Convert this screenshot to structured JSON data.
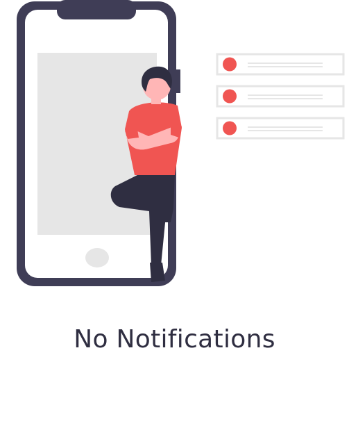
{
  "empty_state": {
    "title": "No Notifications"
  },
  "colors": {
    "phone_frame": "#3f3d56",
    "screen": "#e6e6e6",
    "accent": "#f05552",
    "person_dark": "#2f2e41",
    "skin": "#ffb6b6",
    "card_border": "#e6e6e6",
    "card_line": "#e6e6e6"
  },
  "illustration": {
    "icons": [
      "phone-icon",
      "person-icon",
      "notification-card-icon"
    ],
    "notification_cards_count": 3
  }
}
